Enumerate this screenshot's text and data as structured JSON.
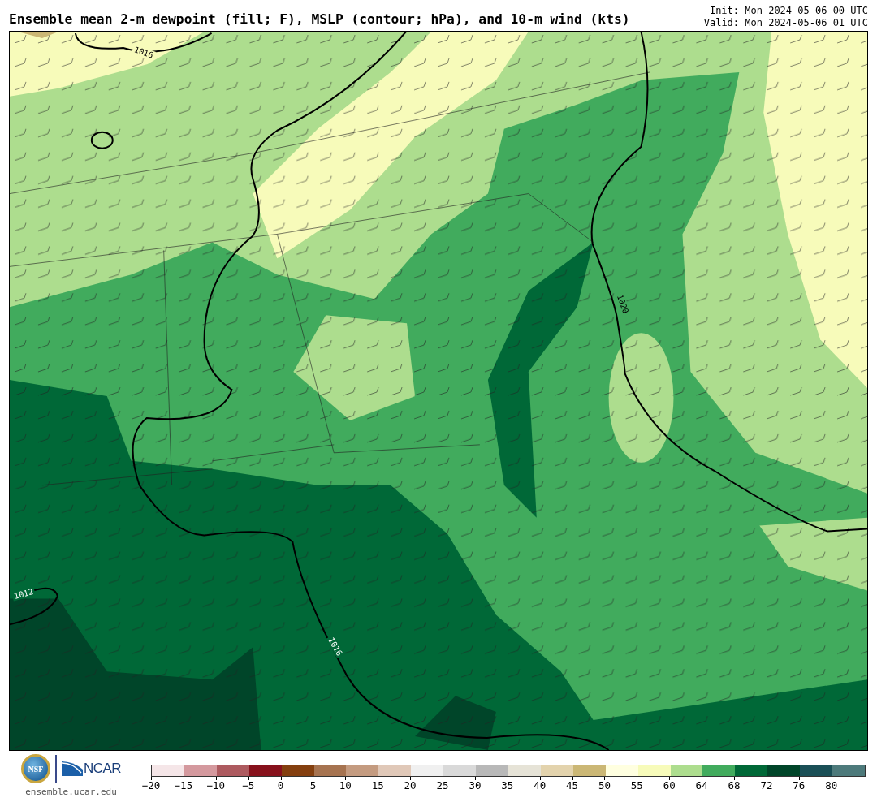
{
  "header": {
    "title": "Ensemble mean 2-m dewpoint (fill; F), MSLP (contour; hPa), and 10-m wind (kts)",
    "init": "Init: Mon 2024-05-06 00 UTC",
    "valid": "Valid: Mon 2024-05-06 01 UTC"
  },
  "map": {
    "contour_labels": [
      "1016",
      "1020",
      "1012",
      "1016"
    ]
  },
  "footer": {
    "nsf_logo": "NSF",
    "ncar_logo": "NCAR",
    "url": "ensemble.ucar.edu"
  },
  "colorbar": {
    "bins": [
      {
        "color": "#f5e6e8"
      },
      {
        "color": "#d4999e"
      },
      {
        "color": "#ad5a5f"
      },
      {
        "color": "#87111c"
      },
      {
        "color": "#843f0f"
      },
      {
        "color": "#a67350"
      },
      {
        "color": "#c49b80"
      },
      {
        "color": "#e0c8b8"
      },
      {
        "color": "#f0f0f0"
      },
      {
        "color": "#d9d9d9"
      },
      {
        "color": "#b8b8b8"
      },
      {
        "color": "#e6e3d7"
      },
      {
        "color": "#e3d3ad"
      },
      {
        "color": "#cbb775"
      },
      {
        "color": "#ffffe0"
      },
      {
        "color": "#f7fbba"
      },
      {
        "color": "#addd8e"
      },
      {
        "color": "#41ab5d"
      },
      {
        "color": "#006837"
      },
      {
        "color": "#004529"
      },
      {
        "color": "#1a4f56"
      },
      {
        "color": "#4d7a7b"
      }
    ],
    "ticks": [
      "−20",
      "−15",
      "−10",
      "−5",
      "0",
      "5",
      "10",
      "15",
      "20",
      "25",
      "30",
      "35",
      "40",
      "45",
      "50",
      "55",
      "60",
      "64",
      "68",
      "72",
      "76",
      "80"
    ]
  }
}
